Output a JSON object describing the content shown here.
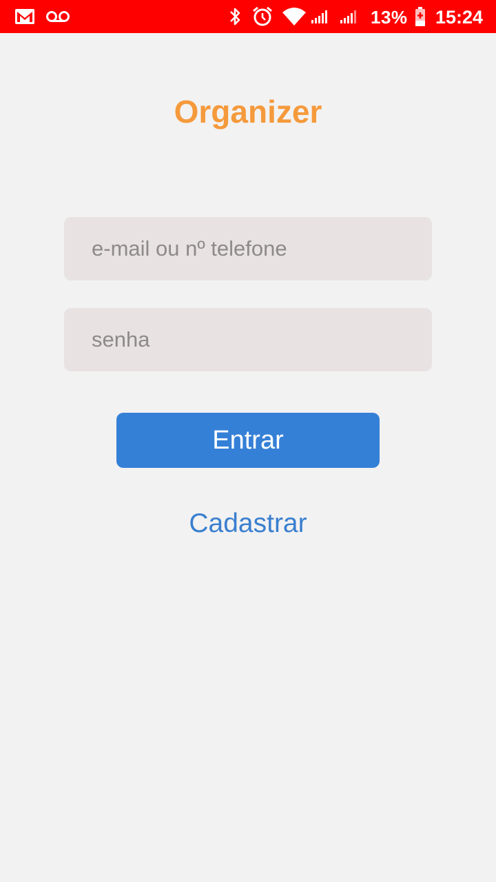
{
  "status_bar": {
    "background": "#ff0000",
    "left_icons": [
      "gmail-icon",
      "voicemail-icon"
    ],
    "right_icons": [
      "bluetooth-icon",
      "alarm-icon",
      "wifi-icon",
      "signal-icon",
      "signal-icon"
    ],
    "battery_percent": "13%",
    "battery_icon": "battery-charging-icon",
    "time": "15:24"
  },
  "app": {
    "title": "Organizer",
    "title_color": "#f59a3c",
    "background": "#f2f2f2"
  },
  "login_form": {
    "email_placeholder": "e-mail ou nº telefone",
    "email_value": "",
    "password_placeholder": "senha",
    "password_value": "",
    "field_background": "#e8e2e2",
    "submit_label": "Entrar",
    "submit_color": "#3580d7",
    "register_label": "Cadastrar",
    "register_color": "#3a7fcf"
  }
}
